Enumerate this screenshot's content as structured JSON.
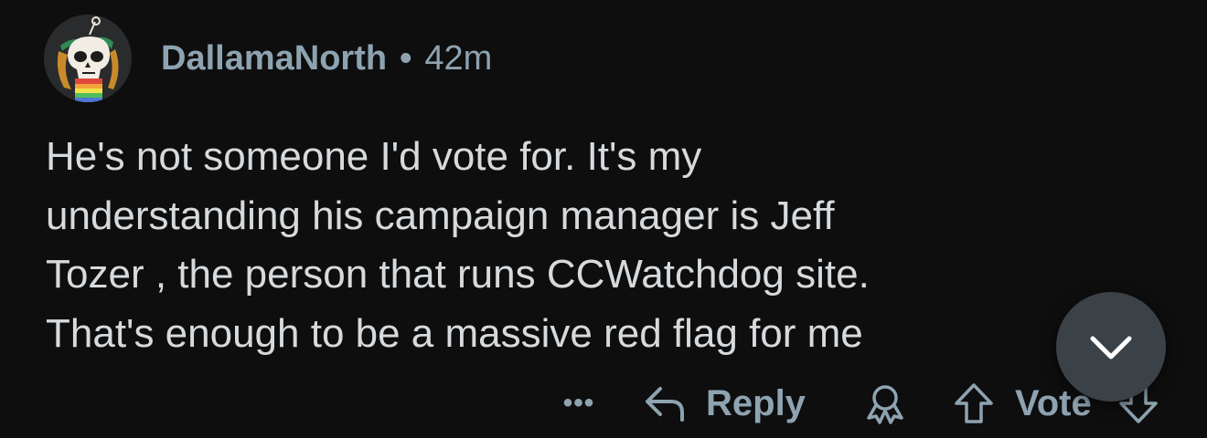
{
  "comment": {
    "author": "DallamaNorth",
    "separator": "•",
    "age": "42m",
    "avatar_icon": "skull-snoo-avatar-icon",
    "body_lines": [
      "He's not someone I'd vote for.  It's my",
      "understanding his campaign manager is Jeff",
      "Tozer , the person that runs CCWatchdog site.",
      "That's enough to be a massive red flag for me"
    ]
  },
  "actions": {
    "more_label": "•••",
    "reply_label": "Reply",
    "award_icon": "award-icon",
    "upvote_icon": "upvote-arrow-icon",
    "vote_label": "Vote",
    "downvote_icon": "downvote-arrow-icon"
  },
  "fab": {
    "icon": "chevron-down-icon"
  },
  "colors": {
    "background": "#0e0e0f",
    "meta_text": "#8ea3b0",
    "body_text": "#d7dadc",
    "fab_background": "#3b4247"
  }
}
